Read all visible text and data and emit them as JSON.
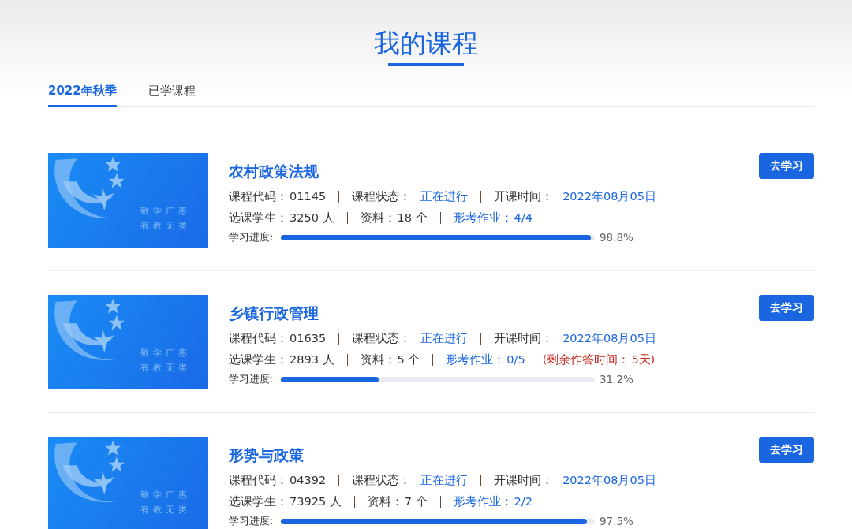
{
  "page_title": "我的课程",
  "tabs": [
    {
      "label": "2022年秋季",
      "selected": true
    },
    {
      "label": "已学课程",
      "selected": false
    }
  ],
  "courses": [
    {
      "title": "农村政策法规",
      "cover_text": [
        "敬学广惠",
        "有教无类"
      ],
      "meta_rows": [
        [
          {
            "kind": "plain",
            "label": "课程代码：",
            "value": "01145"
          },
          {
            "kind": "value-link",
            "label": "课程状态：",
            "value": "正在进行"
          },
          {
            "kind": "value-link",
            "label": "开课时间：",
            "value": "2022年08月05日"
          }
        ],
        [
          {
            "kind": "plain",
            "label": "选课学生：",
            "value": "3250 人"
          },
          {
            "kind": "plain",
            "label": "资料：",
            "value": "18 个"
          },
          {
            "kind": "link",
            "label": "形考作业：",
            "value": "4/4"
          }
        ]
      ],
      "progress": {
        "label": "学习进度:",
        "level": 0.988,
        "reading": "98.8%"
      },
      "button": "去学习"
    },
    {
      "title": "乡镇行政管理",
      "cover_text": [
        "敬学广惠",
        "有教无类"
      ],
      "meta_rows": [
        [
          {
            "kind": "plain",
            "label": "课程代码：",
            "value": "01635"
          },
          {
            "kind": "value-link",
            "label": "课程状态：",
            "value": "正在进行"
          },
          {
            "kind": "value-link",
            "label": "开课时间：",
            "value": "2022年08月05日"
          }
        ],
        [
          {
            "kind": "plain",
            "label": "选课学生：",
            "value": "2893 人"
          },
          {
            "kind": "plain",
            "label": "资料：",
            "value": "5 个"
          },
          {
            "kind": "link",
            "label": "形考作业：",
            "value": "0/5"
          },
          {
            "kind": "warning",
            "label": "(剩余作答时间：",
            "value": "5天)"
          }
        ]
      ],
      "progress": {
        "label": "学习进度:",
        "level": 0.312,
        "reading": "31.2%"
      },
      "button": "去学习"
    },
    {
      "title": "形势与政策",
      "cover_text": [
        "敬学广惠",
        "有教无类"
      ],
      "meta_rows": [
        [
          {
            "kind": "plain",
            "label": "课程代码：",
            "value": "04392"
          },
          {
            "kind": "value-link",
            "label": "课程状态：",
            "value": "正在进行"
          },
          {
            "kind": "value-link",
            "label": "开课时间：",
            "value": "2022年08月05日"
          }
        ],
        [
          {
            "kind": "plain",
            "label": "选课学生：",
            "value": "73925 人"
          },
          {
            "kind": "plain",
            "label": "资料：",
            "value": "7 个"
          },
          {
            "kind": "link",
            "label": "形考作业：",
            "value": "2/2"
          }
        ]
      ],
      "progress": {
        "label": "学习进度:",
        "level": 0.975,
        "reading": "97.5%"
      },
      "button": "去学习"
    }
  ]
}
